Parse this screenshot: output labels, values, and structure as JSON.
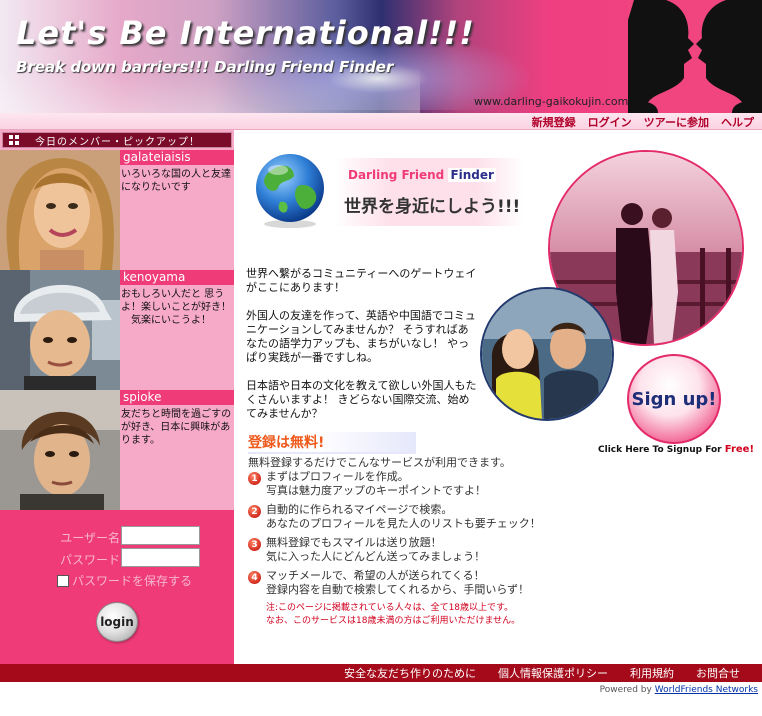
{
  "header": {
    "title": "Let's Be International!!!",
    "tagline": "Break down barriers!!!  Darling Friend Finder",
    "url": "www.darling-gaikokujin.com"
  },
  "top_nav": {
    "register": "新規登録",
    "login": "ログイン",
    "tour": "ツアーに参加",
    "help": "ヘルプ"
  },
  "sidebar": {
    "pickup_title": "今日のメンバー・ピックアップ！",
    "members": [
      {
        "name": "galateiaisis",
        "message": "いろいろな国の人と友達になりたいです"
      },
      {
        "name": "kenoyama",
        "message": "おもしろい人だと 思うよ！楽しいことが好き！ 　気楽にいこうよ！"
      },
      {
        "name": "spioke",
        "message": "友だちと時間を過ごすのが好き、日本に興味があります。"
      }
    ],
    "login": {
      "username_label": "ユーザー名",
      "username_value": "",
      "password_label": "パスワード",
      "password_value": "",
      "remember_label": "パスワードを保存する",
      "button_label": "login"
    }
  },
  "main": {
    "logo_part1": "Darling Friend",
    "logo_part2": "Finder",
    "slogan": "世界を身近にしよう!!!",
    "intro": [
      "世界へ繋がるコミュニティーへのゲートウェイがここにあります！",
      "外国人の友達を作って、英語や中国語でコミュニケーションしてみませんか？ そうすればあなたの語学力アップも、まちがいなし！ やっぱり実践が一番ですしね。",
      "日本語や日本の文化を教えて欲しい外国人もたくさんいますよ！ きどらない国際交流、始めてみませんか？"
    ],
    "signup_button": "Sign up!",
    "signup_caption": "Click Here To Signup For",
    "signup_free": "Free!",
    "free_title": "登録は無料!",
    "free_desc": "無料登録するだけでこんなサービスが利用できます。",
    "features": [
      {
        "num": "1",
        "line1": "まずはプロフィールを作成。",
        "line2": "写真は魅力度アップのキーポイントですよ！"
      },
      {
        "num": "2",
        "line1": "自動的に作られるマイページで検索。",
        "line2": "あなたのプロフィールを見た人のリストも要チェック！"
      },
      {
        "num": "3",
        "line1": "無料登録でもスマイルは送り放題！",
        "line2": "気に入った人にどんどん送ってみましょう！"
      },
      {
        "num": "4",
        "line1": "マッチメールで、希望の人が送られてくる！",
        "line2": "登録内容を自動で検索してくれるから、手間いらず！"
      }
    ],
    "notice_line1": "注:このページに掲載されている人々は、全て18歳以上です。",
    "notice_line2": "なお、このサービスは18歳未満の方はご利用いただけません。"
  },
  "footer": {
    "links": [
      "安全な友だち作りのために",
      "個人情報保護ポリシー",
      "利用規約",
      "お問合せ"
    ],
    "powered_prefix": "Powered by",
    "powered_link": "WorldFriends Networks"
  },
  "colors": {
    "accent_pink": "#ef3b78",
    "sidebar_pink": "#f7aac8",
    "footer_red": "#a40a1a",
    "nav_red": "#b0002a"
  }
}
